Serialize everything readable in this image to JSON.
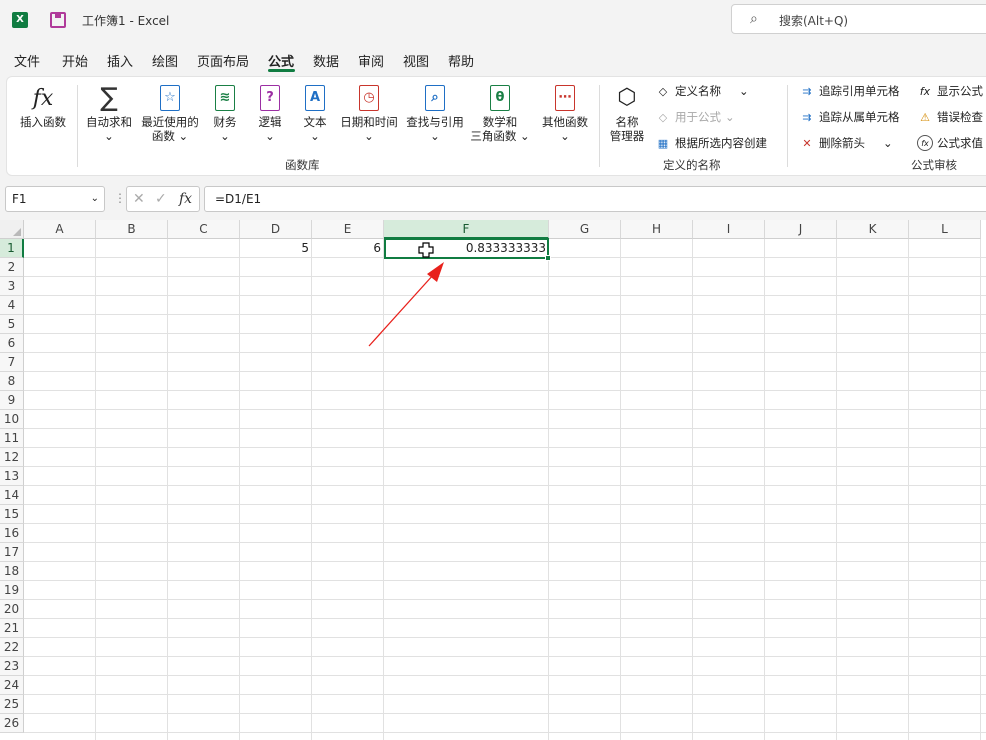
{
  "titlebar": {
    "logo_letter": "X",
    "title": "工作簿1  -  Excel",
    "search_placeholder": "搜索(Alt+Q)"
  },
  "menu": {
    "tabs": [
      "文件",
      "开始",
      "插入",
      "绘图",
      "页面布局",
      "公式",
      "数据",
      "审阅",
      "视图",
      "帮助"
    ],
    "active": "公式"
  },
  "ribbon": {
    "function_library": {
      "group_name": "函数库",
      "insert_function": "插入函数",
      "autosum": "自动求和",
      "recent": "最近使用的",
      "recent_sub": "函数 ⌄",
      "financial": "财务",
      "logical": "逻辑",
      "text": "文本",
      "datetime": "日期和时间",
      "lookup": "查找与引用",
      "math": "数学和",
      "math_sub": "三角函数 ⌄",
      "more": "其他函数",
      "chevron": "⌄"
    },
    "defined_names": {
      "group_name": "定义的名称",
      "name_manager_1": "名称",
      "name_manager_2": "管理器",
      "define_name": "定义名称",
      "use_in_formula": "用于公式",
      "create_from_selection": "根据所选内容创建",
      "chevron": "⌄"
    },
    "formula_auditing": {
      "group_name": "公式审核",
      "trace_precedents": "追踪引用单元格",
      "trace_dependents": "追踪从属单元格",
      "remove_arrows": "删除箭头",
      "show_formulas": "显示公式",
      "error_checking": "错误检查",
      "evaluate_formula": "公式求值",
      "chevron": "⌄"
    }
  },
  "formula_bar": {
    "name_box": "F1",
    "dots": "⋮",
    "cancel": "✕",
    "enter": "✓",
    "fx": "fx",
    "formula": "=D1/E1"
  },
  "grid": {
    "columns": [
      "A",
      "B",
      "C",
      "D",
      "E",
      "F",
      "G",
      "H",
      "I",
      "J",
      "K",
      "L"
    ],
    "selected_column": "F",
    "rows": [
      "1",
      "2",
      "3",
      "4",
      "5",
      "6",
      "7",
      "8",
      "9",
      "10",
      "11",
      "12",
      "13",
      "14",
      "15",
      "16",
      "17",
      "18",
      "19",
      "20",
      "21",
      "22",
      "23",
      "24",
      "25",
      "26"
    ],
    "selected_row": "1",
    "cells": {
      "D1": "5",
      "E1": "6",
      "F1": "0.833333333"
    }
  },
  "annotation": {
    "arrow_color": "#e8211c"
  },
  "colors": {
    "accent": "#107c41"
  }
}
